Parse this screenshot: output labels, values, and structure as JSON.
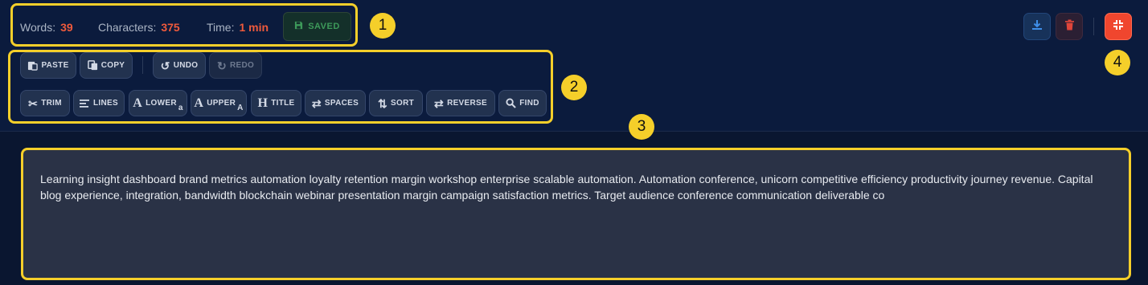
{
  "stats": {
    "words_label": "Words:",
    "words_value": "39",
    "chars_label": "Characters:",
    "chars_value": "375",
    "time_label": "Time:",
    "time_value": "1 min",
    "saved_label": "SAVED"
  },
  "toolbar": {
    "paste": "PASTE",
    "copy": "COPY",
    "undo": "UNDO",
    "redo": "REDO",
    "trim": "TRIM",
    "lines": "LINES",
    "lower": "LOWER",
    "lower_sub": "a",
    "upper": "UPPER",
    "upper_sub": "A",
    "title": "TITLE",
    "spaces": "SPACES",
    "sort": "SORT",
    "reverse": "REVERSE",
    "find": "FIND"
  },
  "annotations": {
    "one": "1",
    "two": "2",
    "three": "3",
    "four": "4"
  },
  "editor": {
    "text": "Learning insight dashboard brand metrics automation loyalty retention margin workshop enterprise scalable automation. Automation conference, unicorn competitive efficiency productivity journey revenue. Capital blog experience, integration, bandwidth blockchain webinar presentation margin campaign satisfaction metrics. Target audience conference communication deliverable co"
  },
  "colors": {
    "accent_red": "#ef5a3c",
    "saved_green": "#3d9a5a",
    "callout_yellow": "#f5cf2a",
    "exit_button": "#f0462e"
  },
  "icons": [
    "save-icon",
    "paste-icon",
    "copy-icon",
    "undo-icon",
    "redo-icon",
    "scissors-icon",
    "lines-icon",
    "lowercase-icon",
    "uppercase-icon",
    "titlecase-icon",
    "spaces-icon",
    "sort-icon",
    "reverse-icon",
    "search-icon",
    "download-icon",
    "trash-icon",
    "collapse-icon"
  ]
}
